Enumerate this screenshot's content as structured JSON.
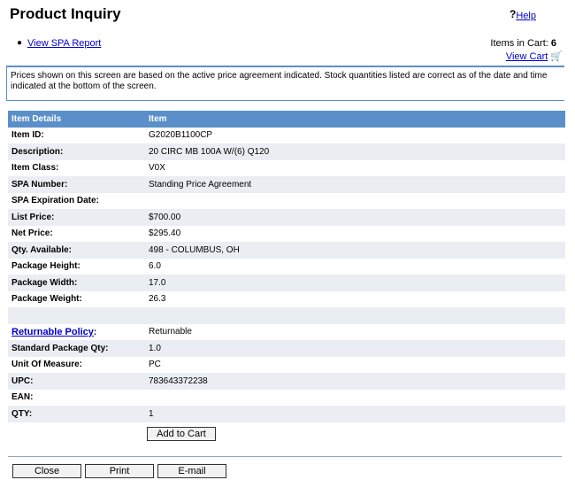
{
  "header": {
    "title": "Product Inquiry",
    "help_label": "Help"
  },
  "links": {
    "spa_report": "View SPA Report"
  },
  "cart": {
    "items_label": "Items in Cart:",
    "items_count": "6",
    "view_cart_label": "View Cart"
  },
  "notice": "Prices shown on this screen are based on the active price agreement indicated. Stock quantities listed are correct as of the date and time indicated at the bottom of the screen.",
  "table": {
    "header": [
      "Item Details",
      "Item"
    ],
    "rows": [
      {
        "label": "Item ID:",
        "value": "G2020B1100CP"
      },
      {
        "label": "Description:",
        "value": "20 CIRC MB 100A W/(6) Q120"
      },
      {
        "label": "Item Class:",
        "value": "V0X"
      },
      {
        "label": "SPA Number:",
        "value": "Standing Price Agreement"
      },
      {
        "label": "SPA Expiration Date:",
        "value": ""
      },
      {
        "label": "List Price:",
        "value": "$700.00"
      },
      {
        "label": "Net Price:",
        "value": "$295.40"
      },
      {
        "label": "Qty. Available:",
        "value": "498 - COLUMBUS, OH"
      },
      {
        "label": "Package Height:",
        "value": "6.0"
      },
      {
        "label": "Package Width:",
        "value": "17.0"
      },
      {
        "label": "Package Weight:",
        "value": "26.3"
      },
      {
        "label": "",
        "value": ""
      },
      {
        "label": "Returnable Policy",
        "value": "Returnable"
      },
      {
        "label": "Standard Package Qty:",
        "value": "1.0"
      },
      {
        "label": "Unit Of Measure:",
        "value": "PC"
      },
      {
        "label": "UPC:",
        "value": "783643372238"
      },
      {
        "label": "EAN:",
        "value": ""
      },
      {
        "label": "QTY:",
        "value": "1"
      }
    ]
  },
  "buttons": {
    "add_to_cart": "Add to Cart",
    "close": "Close",
    "print": "Print",
    "email": "E-mail"
  },
  "colors": {
    "header_bar": "#5a8fc9",
    "alt_row": "#eaeef3",
    "link": "#0000cc"
  }
}
